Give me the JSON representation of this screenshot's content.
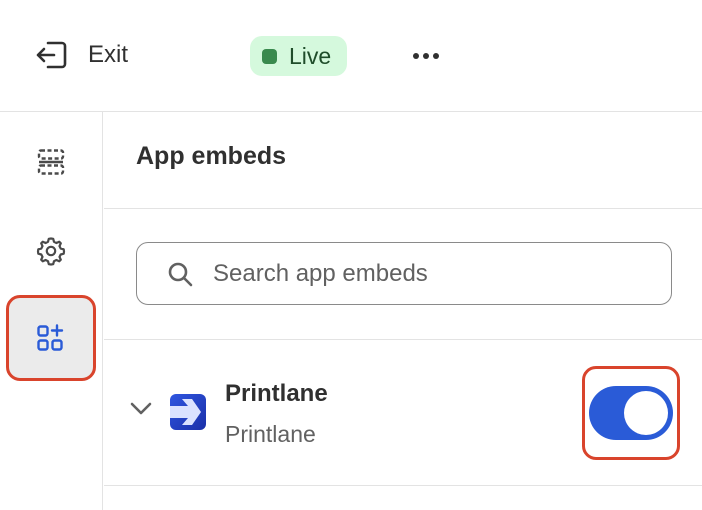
{
  "topbar": {
    "exit_label": "Exit",
    "status_label": "Live",
    "status_color": "#3a8a4e",
    "more_icon": "ellipsis-icon"
  },
  "sidebar": {
    "items": [
      {
        "icon": "sections-icon",
        "active": false
      },
      {
        "icon": "settings-gear-icon",
        "active": false
      },
      {
        "icon": "app-embeds-icon",
        "active": true
      }
    ]
  },
  "panel": {
    "title": "App embeds",
    "search": {
      "placeholder": "Search app embeds",
      "value": ""
    },
    "embeds": [
      {
        "name": "Printlane",
        "subtitle": "Printlane",
        "enabled": true
      }
    ]
  },
  "colors": {
    "toggle_on": "#2a5bd7",
    "highlight": "#d9442c",
    "live_badge_bg": "#d5f9dd"
  }
}
